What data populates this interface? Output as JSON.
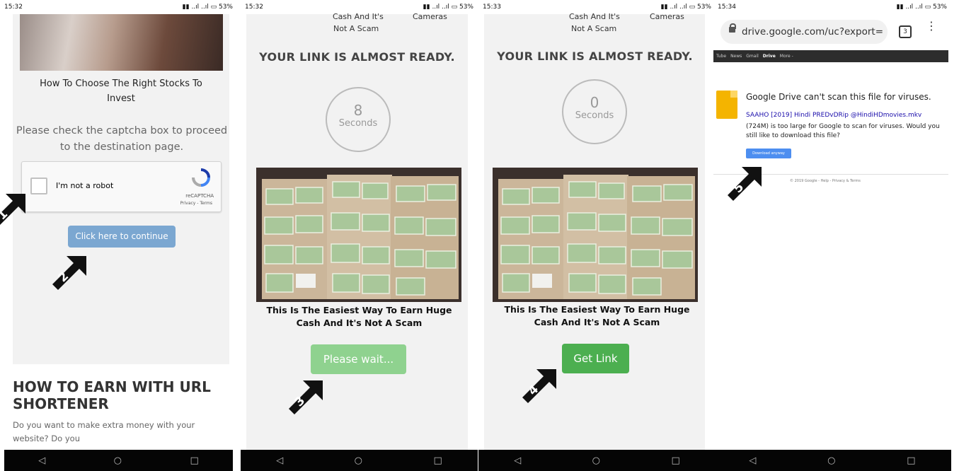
{
  "status": {
    "p1": {
      "time": "15:32",
      "right": "53%"
    },
    "p2": {
      "time": "15:32",
      "right": "53%"
    },
    "p3": {
      "time": "15:33",
      "right": "53%"
    },
    "p4": {
      "time": "15:34",
      "right": "53%"
    }
  },
  "panel1": {
    "article_title": "How To Choose The Right Stocks To Invest",
    "captcha_prompt": "Please check the captcha box to proceed to the destination page.",
    "recaptcha": {
      "label": "I'm not a robot",
      "brand": "reCAPTCHA",
      "links": "Privacy - Terms"
    },
    "continue_button": "Click here to continue",
    "section_heading": "HOW TO EARN WITH URL SHORTENER",
    "section_text": "Do you want to make extra money with your website? Do you"
  },
  "panel2": {
    "top_text_left_1": "Cash And It's",
    "top_text_left_2": "Not A Scam",
    "top_text_right": "Cameras",
    "heading": "YOUR LINK IS ALMOST READY.",
    "countdown_value": "8",
    "countdown_unit": "Seconds",
    "caption": "This Is The Easiest Way To Earn Huge Cash And It's Not A Scam",
    "wait_button": "Please wait..."
  },
  "panel3": {
    "top_text_left_1": "Cash And It's",
    "top_text_left_2": "Not A Scam",
    "top_text_right": "Cameras",
    "heading": "YOUR LINK IS ALMOST READY.",
    "countdown_value": "0",
    "countdown_unit": "Seconds",
    "caption": "This Is The Easiest Way To Earn Huge Cash And It's Not A Scam",
    "get_link_button": "Get Link"
  },
  "panel4": {
    "url": "drive.google.com/uc?export=",
    "tab_count": "3",
    "google_bar": [
      "Tube",
      "News",
      "Gmail",
      "Drive",
      "More -"
    ],
    "warning_title": "Google Drive can't scan this file for viruses.",
    "file_link": "SAAHO [2019] Hindi PREDvDRip @HindiHDmovies.mkv",
    "warning_body": "(724M) is too large for Google to scan for viruses. Would you still like to download this file?",
    "download_button": "Download anyway",
    "footer": "© 2019 Google - Help - Privacy & Terms"
  },
  "arrows": [
    "1",
    "2",
    "3",
    "4",
    "5"
  ],
  "colors": {
    "continue_button": "#7ba7d1",
    "wait_button": "#8fd28f",
    "get_link_button": "#4caf50",
    "drive_button": "#4d8ef0",
    "link_blue": "#1a0dab"
  },
  "icons": {
    "back": "triangle-left",
    "home": "circle",
    "recents": "square",
    "lock": "lock",
    "menu": "vertical-dots",
    "file": "drive-file"
  }
}
